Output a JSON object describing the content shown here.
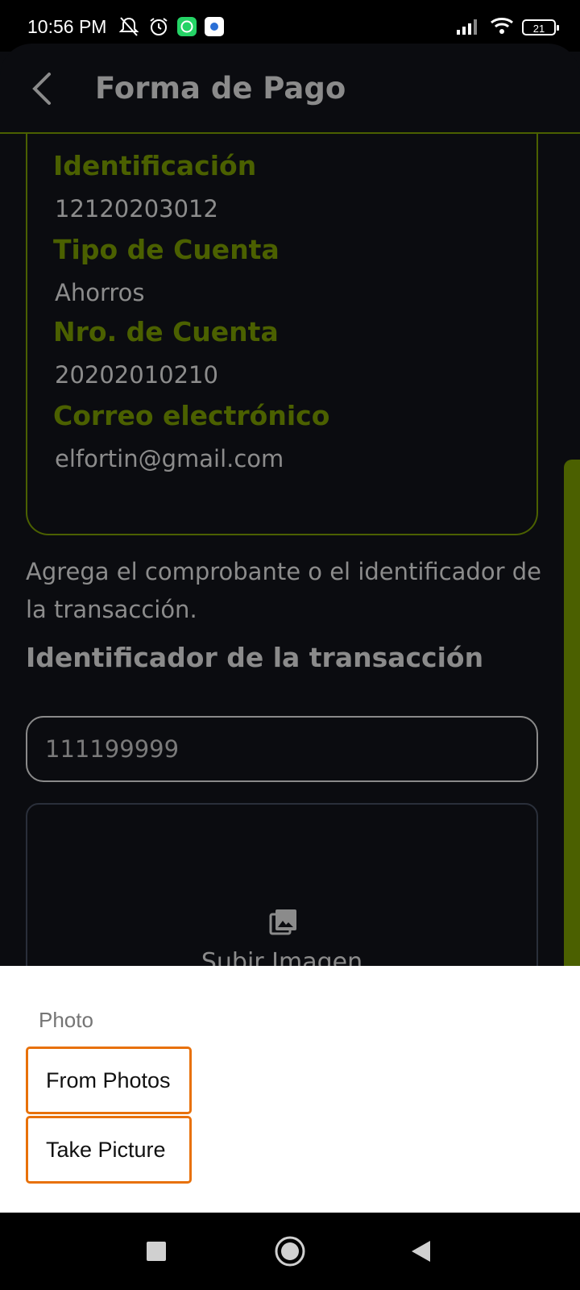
{
  "status_bar": {
    "time": "10:56 PM",
    "battery": "21",
    "icons_left": [
      "mute-icon",
      "alarm-icon",
      "whatsapp-icon",
      "app-icon"
    ],
    "icons_right": [
      "signal-icon",
      "wifi-icon",
      "battery-icon"
    ]
  },
  "header": {
    "title": "Forma de Pago",
    "back_icon": "chevron-left-icon"
  },
  "card": {
    "fields": [
      {
        "label": "Identificación",
        "value": "12120203012"
      },
      {
        "label": "Tipo de Cuenta",
        "value": "Ahorros"
      },
      {
        "label": "Nro. de Cuenta",
        "value": "20202010210"
      },
      {
        "label": "Correo electrónico",
        "value": "elfortin@gmail.com"
      }
    ]
  },
  "instructions": "Agrega el comprobante o el identificador de la transacción.",
  "transaction": {
    "heading": "Identificador de la transacción",
    "value": "111199999"
  },
  "upload": {
    "label": "Subir Imagen",
    "icon": "image-icon"
  },
  "sheet": {
    "title": "Photo",
    "options": [
      "From Photos",
      "Take Picture"
    ]
  },
  "nav": {
    "icons": [
      "recent-apps-icon",
      "home-icon",
      "back-icon"
    ]
  },
  "colors": {
    "accent": "#4b6000",
    "background": "#0b0c10",
    "highlight": "#e8710a"
  }
}
